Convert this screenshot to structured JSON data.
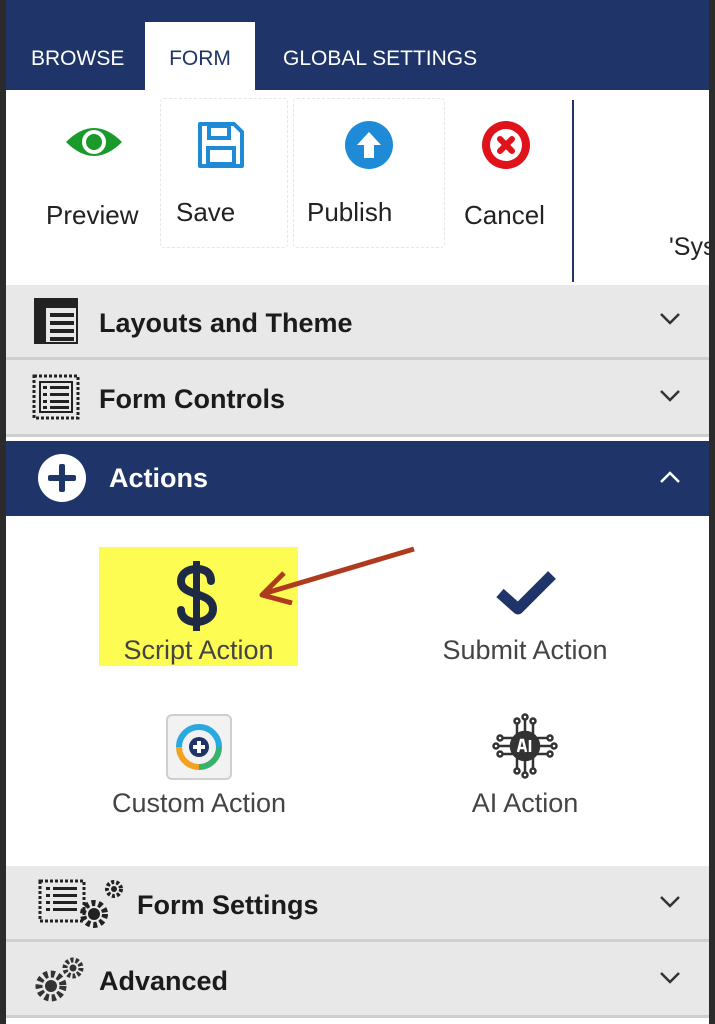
{
  "tabs": [
    {
      "label": "BROWSE",
      "active": false
    },
    {
      "label": "FORM",
      "active": true
    },
    {
      "label": "GLOBAL SETTINGS",
      "active": false
    }
  ],
  "ribbon": {
    "preview": {
      "label": "Preview",
      "icon": "eye-icon",
      "color": "#1a9a2a"
    },
    "save": {
      "label": "Save",
      "icon": "floppy-disk-icon",
      "color": "#1f8ad6"
    },
    "publish": {
      "label": "Publish",
      "icon": "upload-arrow-circle-icon",
      "color": "#1f8ad6"
    },
    "cancel": {
      "label": "Cancel",
      "icon": "close-circle-icon",
      "color": "#e0121a"
    },
    "clipped_text": "'Sys"
  },
  "sections": {
    "layouts": {
      "title": "Layouts and Theme",
      "icon": "layout-icon",
      "expanded": false
    },
    "controls": {
      "title": "Form Controls",
      "icon": "form-controls-icon",
      "expanded": false
    },
    "actions": {
      "title": "Actions",
      "icon": "plus-circle-icon",
      "expanded": true
    },
    "settings": {
      "title": "Form Settings",
      "icon": "form-settings-gear-icon",
      "expanded": false
    },
    "advanced": {
      "title": "Advanced",
      "icon": "gears-icon",
      "expanded": false
    }
  },
  "actions": [
    {
      "label": "Script Action",
      "icon": "dollar-icon",
      "highlighted": true
    },
    {
      "label": "Submit Action",
      "icon": "checkmark-icon",
      "highlighted": false
    },
    {
      "label": "Custom Action",
      "icon": "custom-action-icon",
      "highlighted": false
    },
    {
      "label": "AI Action",
      "icon": "ai-brain-icon",
      "highlighted": false
    }
  ],
  "colors": {
    "navy": "#1f3468",
    "accent_blue": "#1f8ad6",
    "highlight": "#fcfc53",
    "annotation_arrow": "#b03a1e",
    "section_bg": "#e9e8e8"
  }
}
